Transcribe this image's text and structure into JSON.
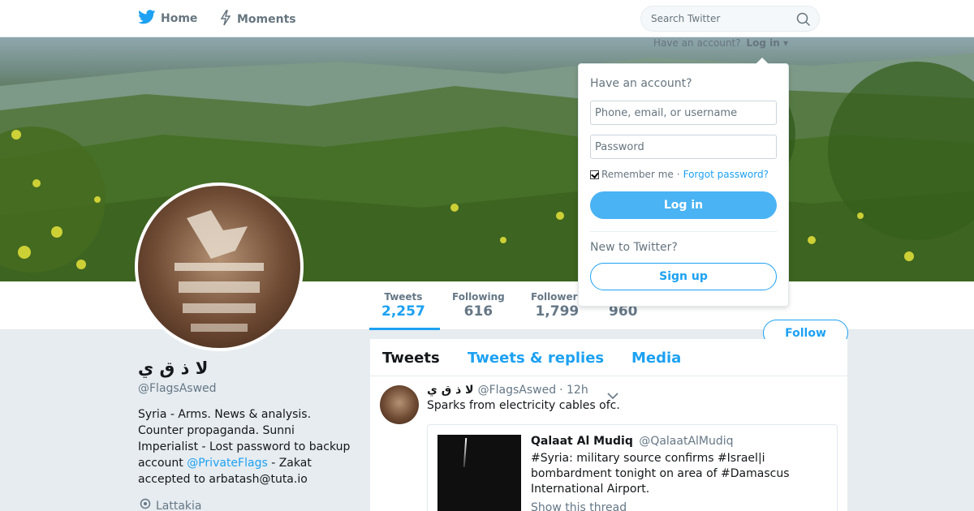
{
  "nav": {
    "home_label": "Home",
    "moments_label": "Moments",
    "search_placeholder": "Search Twitter",
    "account_prompt": "Have an account?",
    "login_label": "Log in"
  },
  "profile": {
    "name": "لا ذ ق ي",
    "handle": "@FlagsAswed",
    "bio_text": "Syria - Arms. News & analysis. Counter propaganda. Sunni Imperialist - Lost password to backup account ",
    "bio_link": "@PrivateFlags",
    "bio_suffix": " - Zakat accepted to arbatash@tuta.io",
    "location": "Lattakia",
    "follow_label": "Follow"
  },
  "stats": {
    "tweets_label": "Tweets",
    "tweets_value": "2,257",
    "following_label": "Following",
    "following_value": "616",
    "followers_label": "Followers",
    "followers_value": "1,799",
    "likes_value": "960"
  },
  "timeline": {
    "tabs": [
      "Tweets",
      "Tweets & replies",
      "Media"
    ],
    "tweet": {
      "name": "لا ذ ق ي",
      "handle": "@FlagsAswed",
      "time": "· 12h",
      "text": "Sparks from electricity cables ofc.",
      "quote": {
        "name": "Qalaat Al Mudiq",
        "handle": "@QalaatAlMudiq",
        "text": "#Syria: military source confirms #Israel|i bombardment tonight on area of #Damascus International Airport.",
        "thread_label": "Show this thread"
      }
    }
  },
  "login_dropdown": {
    "title": "Have an account?",
    "username_placeholder": "Phone, email, or username",
    "password_placeholder": "Password",
    "remember_label": "Remember me",
    "separator": "·",
    "forgot_label": "Forgot password?",
    "login_button": "Log in",
    "new_prompt": "New to Twitter?",
    "signup_button": "Sign up"
  },
  "colors": {
    "accent": "#1da1f2",
    "login_button_bg": "#4ab3f4",
    "muted_text": "#657786",
    "page_bg": "#e6ecf0"
  },
  "icons": {
    "home": "bird-icon",
    "moments": "lightning-icon",
    "search": "search-icon",
    "caret": "chevron-down-icon",
    "location": "location-pin-icon"
  }
}
